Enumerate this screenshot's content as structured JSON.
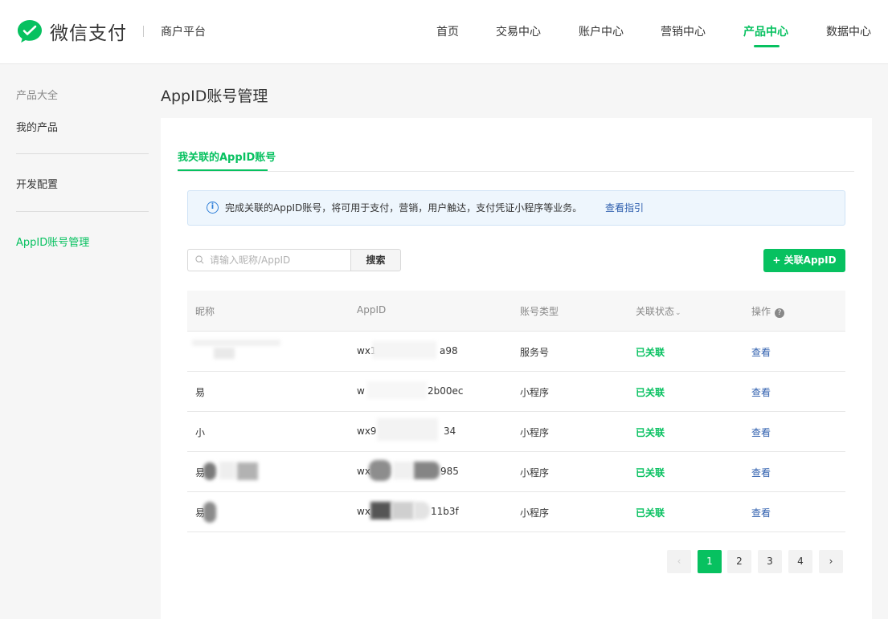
{
  "header": {
    "logo_text": "微信支付",
    "platform": "商户平台",
    "nav": [
      {
        "label": "首页",
        "active": false
      },
      {
        "label": "交易中心",
        "active": false
      },
      {
        "label": "账户中心",
        "active": false
      },
      {
        "label": "营销中心",
        "active": false
      },
      {
        "label": "产品中心",
        "active": true
      },
      {
        "label": "数据中心",
        "active": false
      }
    ]
  },
  "sidebar": {
    "group_title": "产品大全",
    "items": [
      {
        "label": "我的产品",
        "active": false
      },
      {
        "label": "开发配置",
        "active": false
      },
      {
        "label": "AppID账号管理",
        "active": true
      }
    ]
  },
  "main": {
    "title": "AppID账号管理",
    "tab": "我关联的AppID账号",
    "notice": {
      "icon": "info-icon",
      "text": "完成关联的AppID账号，将可用于支付，营销，用户触达，支付凭证小程序等业务。",
      "link": "查看指引"
    },
    "search": {
      "placeholder": "请输入昵称/AppID",
      "value": "",
      "button": "搜索"
    },
    "add_button": "+ 关联AppID",
    "table": {
      "columns": [
        "昵称",
        "AppID",
        "账号类型",
        "关联状态",
        "操作"
      ],
      "rows": [
        {
          "nickname": "",
          "appid_prefix": "wx1",
          "appid_suffix": "a98",
          "type": "服务号",
          "status": "已关联",
          "action": "查看"
        },
        {
          "nickname": "易",
          "appid_prefix": "w",
          "appid_suffix": "2b00ec",
          "type": "小程序",
          "status": "已关联",
          "action": "查看"
        },
        {
          "nickname": "小",
          "appid_prefix": "wx9",
          "appid_suffix": "34",
          "type": "小程序",
          "status": "已关联",
          "action": "查看"
        },
        {
          "nickname": "易",
          "appid_prefix": "wx",
          "appid_suffix": "985",
          "type": "小程序",
          "status": "已关联",
          "action": "查看"
        },
        {
          "nickname": "易",
          "appid_prefix": "wx",
          "appid_suffix": "11b3f",
          "type": "小程序",
          "status": "已关联",
          "action": "查看"
        }
      ]
    },
    "pagination": {
      "prev": "‹",
      "pages": [
        "1",
        "2",
        "3",
        "4"
      ],
      "current": "1",
      "next": "›"
    }
  },
  "colors": {
    "accent": "#07c160",
    "link": "#2f5fae",
    "info": "#2f7fd8"
  }
}
